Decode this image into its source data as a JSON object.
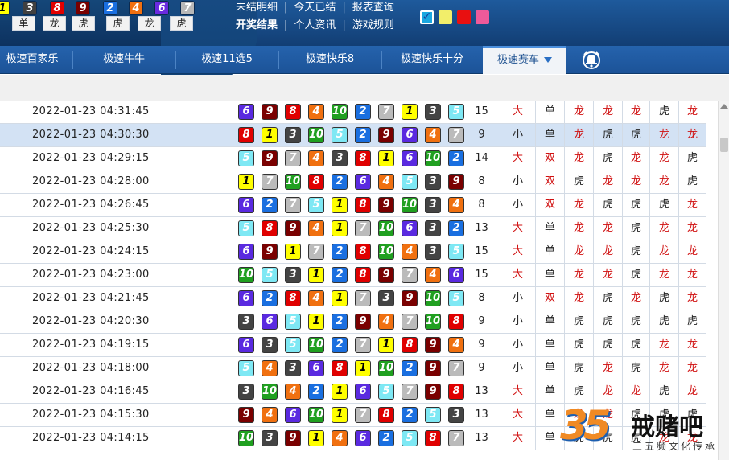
{
  "header": {
    "top_balls": [
      {
        "n": "1",
        "bg": "#ffff00",
        "fg": "#000000"
      },
      {
        "n": "3",
        "bg": "#404040",
        "fg": "#ffffff"
      },
      {
        "n": "8",
        "bg": "#e00000",
        "fg": "#ffffff"
      },
      {
        "n": "9",
        "bg": "#7a0000",
        "fg": "#ffffff"
      },
      {
        "n": "2",
        "bg": "#1a6fe0",
        "fg": "#ffffff"
      },
      {
        "n": "4",
        "bg": "#f07010",
        "fg": "#ffffff"
      },
      {
        "n": "6",
        "bg": "#6a2ae0",
        "fg": "#ffffff"
      },
      {
        "n": "7",
        "bg": "#b8b8b8",
        "fg": "#ffffff"
      }
    ],
    "top_labels": [
      "单",
      "龙",
      "虎",
      "虎",
      "龙",
      "虎"
    ],
    "links_row1": [
      "未结明细",
      "今天已结",
      "报表查询"
    ],
    "links_row2": [
      "开奖结果",
      "个人资讯",
      "游戏规则"
    ],
    "separator": "|",
    "swatches": [
      "#1aa7e0",
      "#f2ee6a",
      "#e81010",
      "#ee5a9a"
    ]
  },
  "nav": {
    "tabs": [
      "极速百家乐",
      "极速牛牛",
      "极速11选5",
      "极速快乐8",
      "极速快乐十分",
      "极速赛车"
    ],
    "active_index": 5
  },
  "palette": {
    "1": {
      "bg": "#ffff00",
      "fg": "#000000"
    },
    "2": {
      "bg": "#1a6fe0",
      "fg": "#ffffff"
    },
    "3": {
      "bg": "#444444",
      "fg": "#ffffff"
    },
    "4": {
      "bg": "#f07010",
      "fg": "#ffffff"
    },
    "5": {
      "bg": "#7ee8f4",
      "fg": "#ffffff"
    },
    "6": {
      "bg": "#5a2ae0",
      "fg": "#ffffff"
    },
    "7": {
      "bg": "#bbbbbb",
      "fg": "#ffffff"
    },
    "8": {
      "bg": "#e00000",
      "fg": "#ffffff"
    },
    "9": {
      "bg": "#7a0000",
      "fg": "#ffffff"
    },
    "10": {
      "bg": "#20a020",
      "fg": "#ffffff"
    }
  },
  "rows": [
    {
      "time": "2022-01-23 04:31:45",
      "balls": [
        6,
        9,
        8,
        4,
        10,
        2,
        7,
        1,
        3,
        5
      ],
      "sum": "15",
      "bs": "大",
      "oe": "单",
      "dt": [
        "龙",
        "龙",
        "龙",
        "虎",
        "龙"
      ]
    },
    {
      "time": "2022-01-23 04:30:30",
      "balls": [
        8,
        1,
        3,
        10,
        5,
        2,
        9,
        6,
        4,
        7
      ],
      "sum": "9",
      "bs": "小",
      "oe": "单",
      "dt": [
        "龙",
        "虎",
        "虎",
        "龙",
        "龙"
      ]
    },
    {
      "time": "2022-01-23 04:29:15",
      "balls": [
        5,
        9,
        7,
        4,
        3,
        8,
        1,
        6,
        10,
        2
      ],
      "sum": "14",
      "bs": "大",
      "oe": "双",
      "dt": [
        "龙",
        "虎",
        "龙",
        "龙",
        "虎"
      ]
    },
    {
      "time": "2022-01-23 04:28:00",
      "balls": [
        1,
        7,
        10,
        8,
        2,
        6,
        4,
        5,
        3,
        9
      ],
      "sum": "8",
      "bs": "小",
      "oe": "双",
      "dt": [
        "虎",
        "龙",
        "龙",
        "龙",
        "虎"
      ]
    },
    {
      "time": "2022-01-23 04:26:45",
      "balls": [
        6,
        2,
        7,
        5,
        1,
        8,
        9,
        10,
        3,
        4
      ],
      "sum": "8",
      "bs": "小",
      "oe": "双",
      "dt": [
        "龙",
        "虎",
        "虎",
        "虎",
        "龙"
      ]
    },
    {
      "time": "2022-01-23 04:25:30",
      "balls": [
        5,
        8,
        9,
        4,
        1,
        7,
        10,
        6,
        3,
        2
      ],
      "sum": "13",
      "bs": "大",
      "oe": "单",
      "dt": [
        "龙",
        "龙",
        "虎",
        "龙",
        "龙"
      ]
    },
    {
      "time": "2022-01-23 04:24:15",
      "balls": [
        6,
        9,
        1,
        7,
        2,
        8,
        10,
        4,
        3,
        5
      ],
      "sum": "15",
      "bs": "大",
      "oe": "单",
      "dt": [
        "龙",
        "龙",
        "虎",
        "龙",
        "龙"
      ]
    },
    {
      "time": "2022-01-23 04:23:00",
      "balls": [
        10,
        5,
        3,
        1,
        2,
        8,
        9,
        7,
        4,
        6
      ],
      "sum": "15",
      "bs": "大",
      "oe": "单",
      "dt": [
        "龙",
        "龙",
        "虎",
        "龙",
        "龙"
      ]
    },
    {
      "time": "2022-01-23 04:21:45",
      "balls": [
        6,
        2,
        8,
        4,
        1,
        7,
        3,
        9,
        10,
        5
      ],
      "sum": "8",
      "bs": "小",
      "oe": "双",
      "dt": [
        "龙",
        "虎",
        "龙",
        "虎",
        "龙"
      ]
    },
    {
      "time": "2022-01-23 04:20:30",
      "balls": [
        3,
        6,
        5,
        1,
        2,
        9,
        4,
        7,
        10,
        8
      ],
      "sum": "9",
      "bs": "小",
      "oe": "单",
      "dt": [
        "虎",
        "虎",
        "虎",
        "虎",
        "虎"
      ]
    },
    {
      "time": "2022-01-23 04:19:15",
      "balls": [
        6,
        3,
        5,
        10,
        2,
        7,
        1,
        8,
        9,
        4
      ],
      "sum": "9",
      "bs": "小",
      "oe": "单",
      "dt": [
        "虎",
        "虎",
        "虎",
        "龙",
        "龙"
      ]
    },
    {
      "time": "2022-01-23 04:18:00",
      "balls": [
        5,
        4,
        3,
        6,
        8,
        1,
        10,
        2,
        9,
        7
      ],
      "sum": "9",
      "bs": "小",
      "oe": "单",
      "dt": [
        "虎",
        "龙",
        "虎",
        "龙",
        "龙"
      ]
    },
    {
      "time": "2022-01-23 04:16:45",
      "balls": [
        3,
        10,
        4,
        2,
        1,
        6,
        5,
        7,
        9,
        8
      ],
      "sum": "13",
      "bs": "大",
      "oe": "单",
      "dt": [
        "虎",
        "龙",
        "龙",
        "虎",
        "龙"
      ]
    },
    {
      "time": "2022-01-23 04:15:30",
      "balls": [
        9,
        4,
        6,
        10,
        1,
        7,
        8,
        2,
        5,
        3
      ],
      "sum": "13",
      "bs": "大",
      "oe": "单",
      "dt": [
        "龙",
        "龙",
        "虎",
        "虎",
        "虎"
      ]
    },
    {
      "time": "2022-01-23 04:14:15",
      "balls": [
        10,
        3,
        9,
        1,
        4,
        6,
        2,
        5,
        8,
        7
      ],
      "sum": "13",
      "bs": "大",
      "oe": "单",
      "dt": [
        "虎",
        "虎",
        "虎",
        "龙",
        "龙"
      ]
    }
  ],
  "highlight_row": 1,
  "watermark": {
    "number": "35",
    "name": "戒赌吧",
    "sub": "三五频文化传承"
  }
}
